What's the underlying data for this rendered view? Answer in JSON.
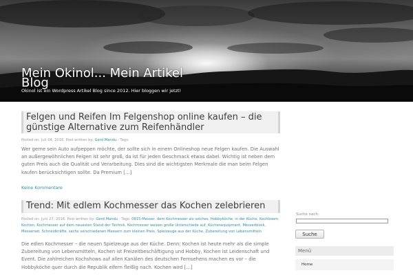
{
  "site": {
    "title": "Mein Okinol... Mein Artikel Blog",
    "description": "Okinol ist ein Wordpress Artikel Blog since 2012. Hier bloggen wir jetzt!"
  },
  "posts": [
    {
      "title": "Felgen und Reifen Im Felgenshop online kaufen – die günstige Alternative zum Reifenhändler",
      "posted_on_label": "Posted on:",
      "date": "Juli 04, 2016.",
      "posted_by_label": "Post written by:",
      "author": "Gerd Mandu",
      "tags_label": "- Tags:",
      "tags": [],
      "excerpt": "Wer gerne sein Auto aufpeppen möchte, der sollte sich in einem Onlineshop neue Felgen kaufen. Die Auswahl an außergewöhnlichen Felgen ist sehr groß, da ist für jeden Geschmack etwas dabei. Wichtig ist neben dem guten Preis auch die Qualität und Verarbeitung. Dies sind die wichtigsten Merkmale die man beim Felgen kaufen berücksichtigen sollte. Da Premium […]",
      "comments": "Keine Kommentare"
    },
    {
      "title": "Trend: Mit edlem Kochmesser das Kochen zelebrieren",
      "posted_on_label": "Posted on:",
      "date": "Juni 27, 2016.",
      "posted_by_label": "Post written by:",
      "author": "Gerd Mandu",
      "tags_label": "- Tags:",
      "tags": [
        "0815-Messer",
        "dem Kochmesser als solches",
        "Hobbyköche",
        "in der Küche",
        "Kochboom",
        "Kochen",
        "Kochmesser auf dem neuesten Stand der Technik",
        "Kochmesser weisen große Unterschiede auf",
        "Küchenequipment",
        "Messerblock",
        "Messerset",
        "Schneidkräfte",
        "sechs verschiedenen Messern zum kleinen Preis",
        "Spielzeuge aus der Küche",
        "Zubereitung von Lebensmitteln"
      ],
      "excerpt": "Die edlen Kochmesser – die neuen Spielzeuge aus der Küche. Denn: Kochen ist heute mehr als die simple Zubereitung von Lebensmitteln, Kochen ist Freizeitbeschäftigung und Hobby, Kochen ist Leidenschaft und Event. Die zahlreichen Kochshows auf allen Kanälen des deutschen Fernsehens machen es vor – die Hobbyköche quer durch die Republik eifern fleißig nach. Kochen wird […]"
    }
  ],
  "sidebar": {
    "search_label": "Suche nach:",
    "search_value": "",
    "search_button": "Suche",
    "menu_title": "Menü",
    "menu_items": [
      "Home"
    ]
  }
}
